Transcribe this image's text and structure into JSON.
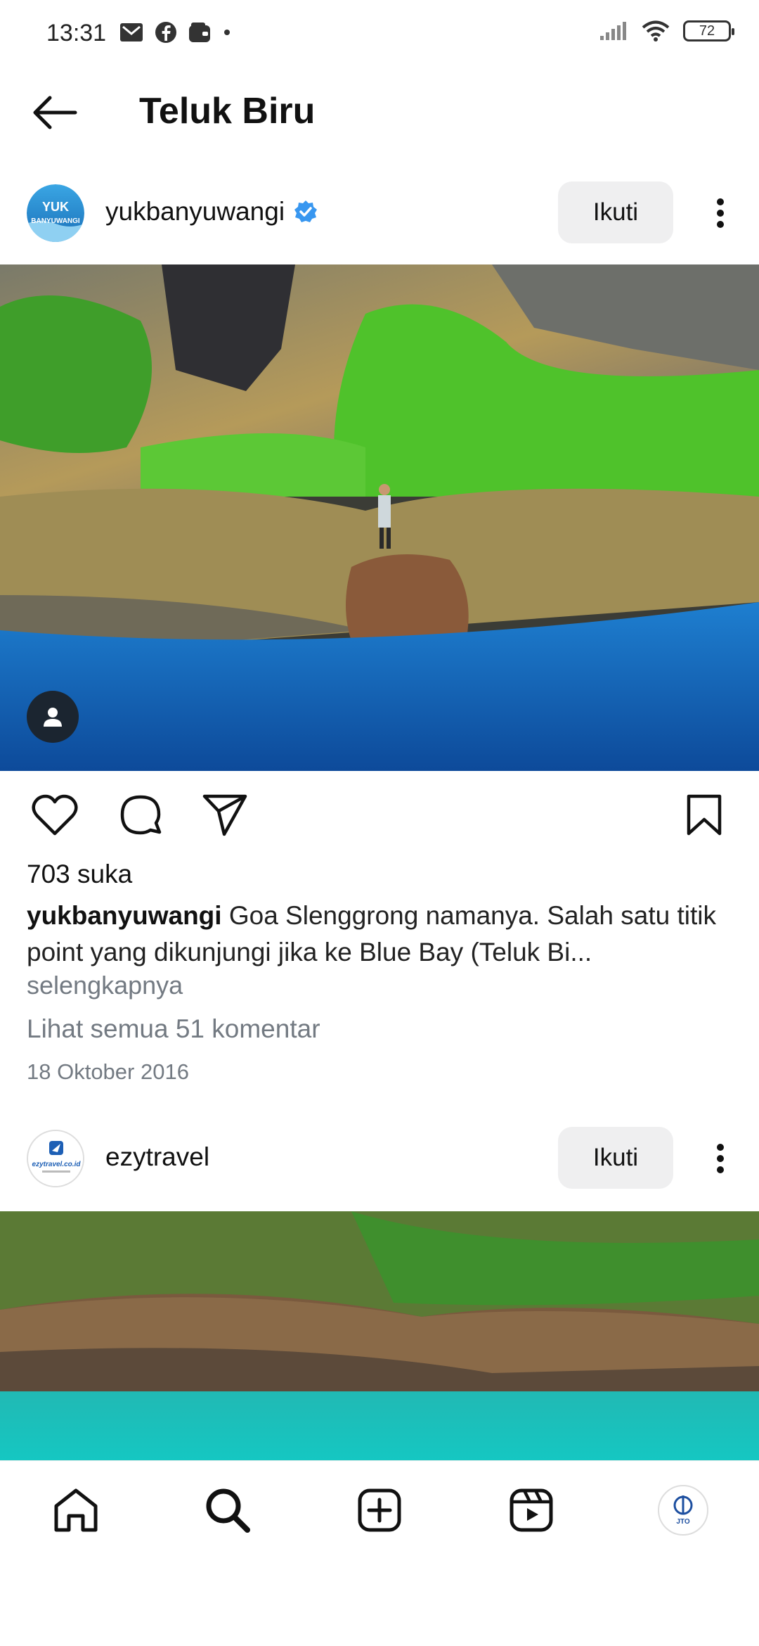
{
  "status_bar": {
    "time": "13:31",
    "battery": "72",
    "left_icons": [
      "gmail-icon",
      "facebook-icon",
      "wallet-icon",
      "dot-icon"
    ],
    "right_icons": [
      "signal-icon",
      "wifi-icon",
      "battery-icon"
    ]
  },
  "header": {
    "title": "Teluk Biru",
    "back_icon": "back-arrow-icon"
  },
  "posts": [
    {
      "username": "yukbanyuwangi",
      "verified": true,
      "avatar_text_1": "YUK",
      "avatar_text_2": "BANYUWANGI",
      "follow_label": "Ikuti",
      "likes": "703 suka",
      "caption_user": "yukbanyuwangi",
      "caption_text": "Goa Slenggrong namanya. Salah satu titik point yang dikunjungi jika ke Blue Bay (Teluk Bi...",
      "more_label": "selengkapnya",
      "comments_label": "Lihat semua 51 komentar",
      "date": "18 Oktober 2016"
    },
    {
      "username": "ezytravel",
      "avatar_text": "ezytravel.co.id",
      "follow_label": "Ikuti"
    }
  ],
  "bottom_nav": {
    "items": [
      "home-icon",
      "search-icon",
      "create-icon",
      "reels-icon",
      "profile-avatar"
    ],
    "profile_text": "JTO"
  },
  "colors": {
    "follow_bg": "#efeff0",
    "muted_text": "#737a82",
    "verified": "#3897f0"
  }
}
